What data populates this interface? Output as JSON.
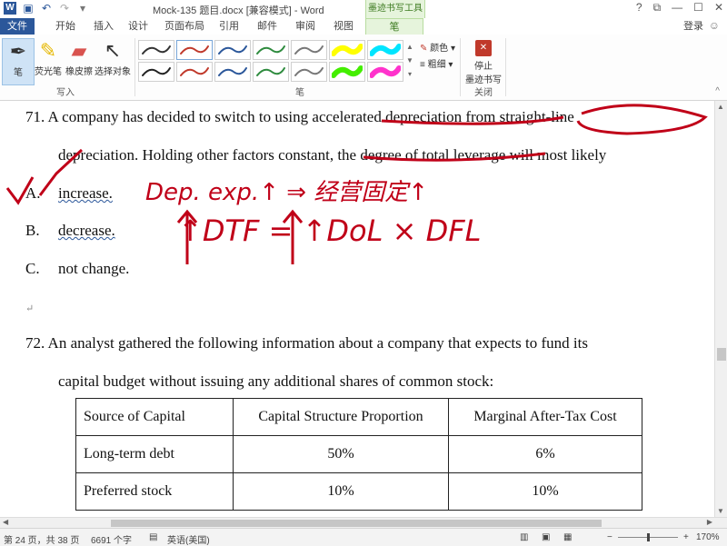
{
  "titlebar": {
    "doc_title": "Mock-135 题目.docx [兼容模式] - Word",
    "context_tab_title": "墨迹书写工具",
    "qat": [
      "word-logo",
      "save",
      "undo",
      "redo",
      "customize"
    ],
    "window_controls": [
      "?",
      "restore",
      "minimize",
      "maximize",
      "close"
    ]
  },
  "tabs": {
    "file": "文件",
    "items": [
      "开始",
      "插入",
      "设计",
      "页面布局",
      "引用",
      "邮件",
      "审阅",
      "视图"
    ],
    "pen": "笔",
    "login": "登录"
  },
  "ribbon": {
    "tools": [
      "笔",
      "荧光笔",
      "橡皮擦",
      "选择对象"
    ],
    "group_write": "写入",
    "group_pens": "笔",
    "color_label": "颜色",
    "thickness_label": "粗细",
    "stop_label_1": "停止",
    "stop_label_2": "墨迹书写",
    "group_close": "关闭",
    "pen_colors": [
      "#333333",
      "#c0392b",
      "#2b579a",
      "#2e8b3e",
      "#777777",
      "#ffff00",
      "#00e5ff",
      "#222222",
      "#c0392b",
      "#2b579a",
      "#2e8b3e",
      "#777777",
      "#44ee00",
      "#ff33cc"
    ]
  },
  "document": {
    "q71_line1": "71.  A company has decided to switch to using accelerated depreciation from straight-line",
    "q71_line2": "depreciation. Holding other factors constant, the degree of total leverage will most likely",
    "opt_a_label": "A.",
    "opt_a": "increase.",
    "opt_b_label": "B.",
    "opt_b": "decrease.",
    "opt_c_label": "C.",
    "opt_c": "not change.",
    "para_mark": "↵",
    "q72_line1": "72.  An analyst gathered the following information about a company that expects to fund its",
    "q72_line2": "capital budget without issuing any additional shares of common stock:",
    "handwriting_line1": "Dep. exp.↑ ⇒ 经营固定↑",
    "handwriting_line2": "↑DTF = ↑DoL × DFL",
    "table": {
      "headers": [
        "Source of Capital",
        "Capital Structure Proportion",
        "Marginal After-Tax Cost"
      ],
      "rows": [
        [
          "Long-term debt",
          "50%",
          "6%"
        ],
        [
          "Preferred stock",
          "10%",
          "10%"
        ]
      ]
    }
  },
  "status": {
    "page": "第 24 页，共 38 页",
    "words": "6691 个字",
    "lang": "英语(美国)",
    "zoom": "170%",
    "minus": "−",
    "plus": "+"
  }
}
